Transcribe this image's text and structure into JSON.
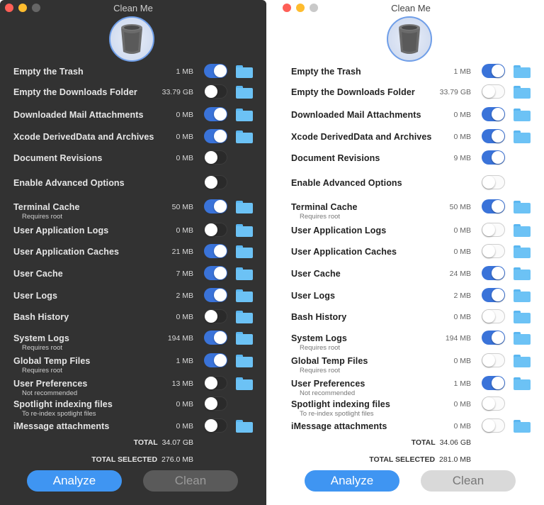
{
  "app": {
    "title": "Clean Me"
  },
  "icons": {
    "app_icon": "trash-can-icon",
    "folder": "folder-icon"
  },
  "colors": {
    "toggle_on": "#3a73d9",
    "analyze_button": "#3f95f2",
    "folder": "#6cc2f5"
  },
  "windows": [
    {
      "theme": "dark",
      "items": [
        {
          "label": "Empty the Trash",
          "sub": "",
          "size": "1 MB",
          "enabled": true,
          "folder": true
        },
        {
          "label": "Empty the Downloads Folder",
          "sub": "",
          "size": "33.79 GB",
          "enabled": false,
          "folder": true
        },
        {
          "label": "Downloaded Mail Attachments",
          "sub": "",
          "size": "0 MB",
          "enabled": true,
          "folder": true
        },
        {
          "label": "Xcode DerivedData and Archives",
          "sub": "",
          "size": "0 MB",
          "enabled": true,
          "folder": true
        },
        {
          "label": "Document Revisions",
          "sub": "",
          "size": "0 MB",
          "enabled": false,
          "folder": false
        },
        {
          "label": "Enable Advanced Options",
          "sub": "",
          "size": "",
          "enabled": false,
          "folder": false
        },
        {
          "label": "Terminal Cache",
          "sub": "Requires root",
          "size": "50 MB",
          "enabled": true,
          "folder": true
        },
        {
          "label": "User Application Logs",
          "sub": "",
          "size": "0 MB",
          "enabled": false,
          "folder": true
        },
        {
          "label": "User Application Caches",
          "sub": "",
          "size": "21 MB",
          "enabled": true,
          "folder": true
        },
        {
          "label": "User Cache",
          "sub": "",
          "size": "7 MB",
          "enabled": true,
          "folder": true
        },
        {
          "label": "User Logs",
          "sub": "",
          "size": "2 MB",
          "enabled": true,
          "folder": true
        },
        {
          "label": "Bash History",
          "sub": "",
          "size": "0 MB",
          "enabled": false,
          "folder": true
        },
        {
          "label": "System Logs",
          "sub": "Requires root",
          "size": "194 MB",
          "enabled": true,
          "folder": true
        },
        {
          "label": "Global Temp Files",
          "sub": "Requires root",
          "size": "1 MB",
          "enabled": true,
          "folder": true
        },
        {
          "label": "User Preferences",
          "sub": "Not recommended",
          "size": "13 MB",
          "enabled": false,
          "folder": true
        },
        {
          "label": "Spotlight indexing files",
          "sub": "To re-index spotlight files",
          "size": "0 MB",
          "enabled": false,
          "folder": false
        },
        {
          "label": "iMessage attachments",
          "sub": "",
          "size": "0 MB",
          "enabled": false,
          "folder": true
        }
      ],
      "total_label": "TOTAL",
      "total_value": "34.07 GB",
      "selected_label": "TOTAL SELECTED",
      "selected_value": "276.0 MB",
      "analyze_label": "Analyze",
      "clean_label": "Clean"
    },
    {
      "theme": "light",
      "items": [
        {
          "label": "Empty the Trash",
          "sub": "",
          "size": "1 MB",
          "enabled": true,
          "folder": true
        },
        {
          "label": "Empty the Downloads Folder",
          "sub": "",
          "size": "33.79 GB",
          "enabled": false,
          "folder": true
        },
        {
          "label": "Downloaded Mail Attachments",
          "sub": "",
          "size": "0 MB",
          "enabled": true,
          "folder": true
        },
        {
          "label": "Xcode DerivedData and Archives",
          "sub": "",
          "size": "0 MB",
          "enabled": true,
          "folder": true
        },
        {
          "label": "Document Revisions",
          "sub": "",
          "size": "9 MB",
          "enabled": true,
          "folder": false
        },
        {
          "label": "Enable Advanced Options",
          "sub": "",
          "size": "",
          "enabled": false,
          "folder": false
        },
        {
          "label": "Terminal Cache",
          "sub": "Requires root",
          "size": "50 MB",
          "enabled": true,
          "folder": true
        },
        {
          "label": "User Application Logs",
          "sub": "",
          "size": "0 MB",
          "enabled": false,
          "folder": true
        },
        {
          "label": "User Application Caches",
          "sub": "",
          "size": "0 MB",
          "enabled": false,
          "folder": true
        },
        {
          "label": "User Cache",
          "sub": "",
          "size": "24 MB",
          "enabled": true,
          "folder": true
        },
        {
          "label": "User Logs",
          "sub": "",
          "size": "2 MB",
          "enabled": true,
          "folder": true
        },
        {
          "label": "Bash History",
          "sub": "",
          "size": "0 MB",
          "enabled": false,
          "folder": true
        },
        {
          "label": "System Logs",
          "sub": "Requires root",
          "size": "194 MB",
          "enabled": true,
          "folder": true
        },
        {
          "label": "Global Temp Files",
          "sub": "Requires root",
          "size": "0 MB",
          "enabled": false,
          "folder": true
        },
        {
          "label": "User Preferences",
          "sub": "Not recommended",
          "size": "1 MB",
          "enabled": true,
          "folder": true
        },
        {
          "label": "Spotlight indexing files",
          "sub": "To re-index spotlight files",
          "size": "0 MB",
          "enabled": false,
          "folder": false
        },
        {
          "label": "iMessage attachments",
          "sub": "",
          "size": "0 MB",
          "enabled": false,
          "folder": true
        }
      ],
      "total_label": "TOTAL",
      "total_value": "34.06 GB",
      "selected_label": "TOTAL SELECTED",
      "selected_value": "281.0 MB",
      "analyze_label": "Analyze",
      "clean_label": "Clean"
    }
  ]
}
